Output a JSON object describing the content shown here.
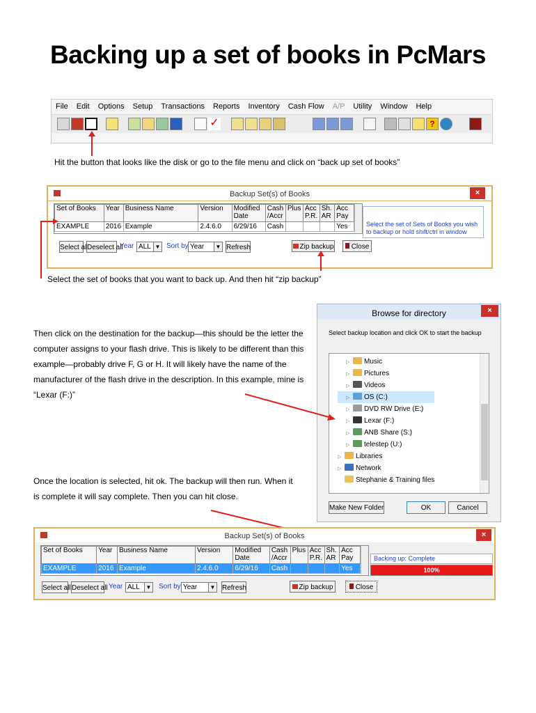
{
  "title": "Backing up a set of books in PcMars",
  "menubar": {
    "items": [
      "File",
      "Edit",
      "Options",
      "Setup",
      "Transactions",
      "Reports",
      "Inventory",
      "Cash Flow",
      "A/P",
      "Utility",
      "Window",
      "Help"
    ]
  },
  "step1": {
    "instruction": "Hit the button that looks like the disk or go to the file menu and click on “back up set of books”"
  },
  "backup_window": {
    "title": "Backup Set(s) of Books",
    "close": "×",
    "columns": [
      "Set of Books",
      "Year",
      "Business Name",
      "Version",
      "Modified Date",
      "Cash /Accr",
      "Plus",
      "Acc P.R.",
      "Sh. AR",
      "Acc Pay"
    ],
    "row": [
      "EXAMPLE",
      "2016",
      "Example",
      "2.4.6.0",
      "6/29/16",
      "Cash",
      "",
      "",
      "",
      "Yes"
    ],
    "hint": "Select the set of Sets of Books you wish to backup or hold shift/ctrl in window",
    "select_all": "Select all",
    "deselect_all": "Deselect all",
    "year_label": "Year",
    "year_value": "ALL",
    "sortby_label": "Sort by",
    "sortby_value": "Year",
    "refresh": "Refresh",
    "zip": "Zip backup",
    "close_btn": "Close"
  },
  "step2": {
    "instruction": "Select the set of books that you want to back up. And then hit “zip backup”"
  },
  "browse": {
    "title": "Browse for directory",
    "close": "×",
    "prompt": "Select backup location and click OK to start the backup",
    "items": [
      "Music",
      "Pictures",
      "Videos",
      "OS (C:)",
      "DVD RW Drive (E:)",
      "Lexar (F:)",
      "ANB Share (S:)",
      "telestep (U:)",
      "Libraries",
      "Network",
      "Stephanie & Training files"
    ],
    "make_folder": "Make New Folder",
    "ok": "OK",
    "cancel": "Cancel"
  },
  "step3": {
    "instruction": "Then click on  the destination for the backup—this should be the letter the computer assigns to your flash drive. This is likely to be different than this example—probably drive F, G or H. It will likely have the name of the manufacturer of the flash drive in the description. In this example, mine is “Lexar (F:)”"
  },
  "step4": {
    "instruction": "Once the location is selected, hit ok. The backup will then run. When it is complete it will say complete. Then you can hit close."
  },
  "backup_window2": {
    "title": "Backup Set(s) of Books",
    "close": "×",
    "columns": [
      "Set of Books",
      "Year",
      "Business Name",
      "Version",
      "Modified Date",
      "Cash /Accr",
      "Plus",
      "Acc P.R.",
      "Sh. AR",
      "Acc Pay"
    ],
    "row": [
      "EXAMPLE",
      "2016",
      "Example",
      "2.4.6.0",
      "6/29/16",
      "Cash",
      "",
      "",
      "",
      "Yes"
    ],
    "status": "Backing up: Complete",
    "progress_text": "100%",
    "progress": 1.0,
    "select_all": "Select all",
    "deselect_all": "Deselect all",
    "year_label": "Year",
    "year_value": "ALL",
    "sortby_label": "Sort by",
    "sortby_value": "Year",
    "refresh": "Refresh",
    "zip": "Zip backup",
    "close_btn": "Close"
  },
  "colors": {
    "arrow": "#e02020",
    "progress": "#e81818",
    "highlight": "#3399ff",
    "window_border": "#e0b060",
    "title_red": "#c9302c"
  }
}
